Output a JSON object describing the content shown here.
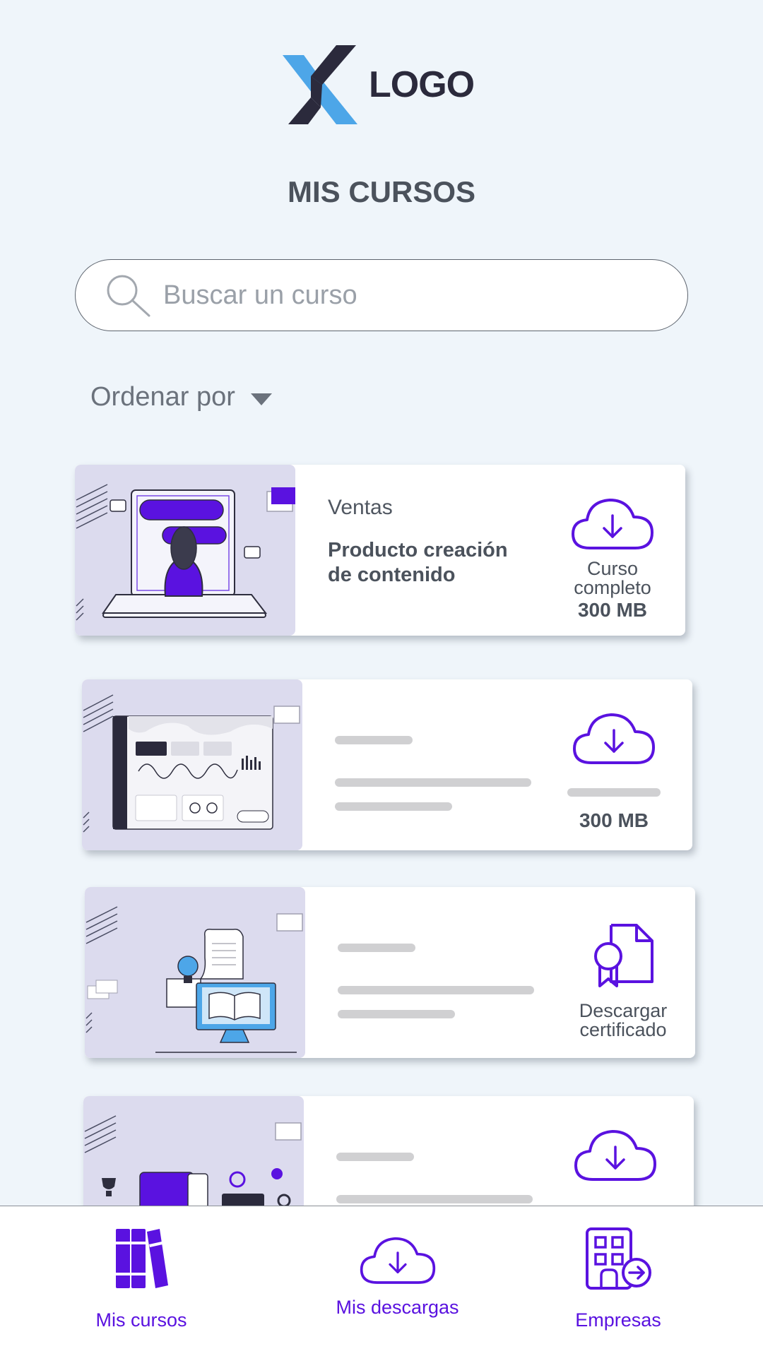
{
  "logo": {
    "text": "LOGO"
  },
  "page_title": "MIS CURSOS",
  "search": {
    "placeholder": "Buscar un curso",
    "value": ""
  },
  "sort": {
    "label": "Ordenar por"
  },
  "courses": [
    {
      "category": "Ventas",
      "title": "Producto creación de contenido",
      "action_line1": "Curso",
      "action_line2": "completo",
      "size": "300 MB"
    },
    {
      "size": "300 MB"
    },
    {
      "action_line1": "Descargar",
      "action_line2": "certificado"
    }
  ],
  "bottom_nav": [
    {
      "label": "Mis cursos"
    },
    {
      "label": "Mis descargas"
    },
    {
      "label": "Empresas"
    }
  ],
  "colors": {
    "accent": "#5a12e0",
    "logo_blue": "#4da6e8",
    "logo_dark": "#2b2a3c",
    "background": "#eff5fa",
    "thumb_bg": "#dcdbee"
  },
  "icons": {
    "search": "search-icon",
    "sort": "caret-down-icon",
    "download": "cloud-download-icon",
    "certificate": "certificate-icon",
    "courses": "books-icon",
    "companies": "building-icon"
  }
}
